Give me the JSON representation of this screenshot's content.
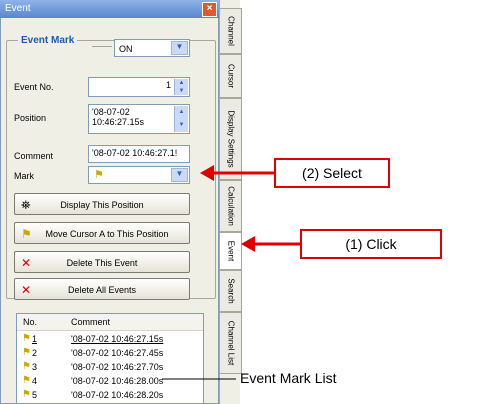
{
  "window": {
    "title": "Event"
  },
  "event_mark": {
    "label": "Event Mark",
    "state": "ON"
  },
  "fields": {
    "event_no_label": "Event No.",
    "event_no_value": "1",
    "position_label": "Position",
    "position_line1": "'08-07-02",
    "position_line2": "10:46:27.15s",
    "comment_label": "Comment",
    "comment_value": "'08-07-02 10:46:27.1!",
    "mark_label": "Mark"
  },
  "buttons": {
    "display": "Display This Position",
    "move": "Move Cursor A to This Position",
    "delete_event": "Delete This Event",
    "delete_all": "Delete All Events"
  },
  "list": {
    "headers": [
      "No.",
      "Comment"
    ],
    "rows": [
      {
        "no": "1",
        "comment": "'08-07-02 10:46:27.15s"
      },
      {
        "no": "2",
        "comment": "'08-07-02 10:46:27.45s"
      },
      {
        "no": "3",
        "comment": "'08-07-02 10:46:27.70s"
      },
      {
        "no": "4",
        "comment": "'08-07-02 10:46:28.00s"
      },
      {
        "no": "5",
        "comment": "'08-07-02 10:46:28.20s"
      }
    ]
  },
  "tabs": [
    "Channel",
    "Cursor",
    "Display Settings",
    "Calculation",
    "Event",
    "Search",
    "Channel List"
  ],
  "callouts": {
    "select": "(2) Select",
    "click": "(1) Click",
    "list": "Event Mark List"
  },
  "colors": {
    "accent": "#1b58b8",
    "callout": "#e00000"
  }
}
